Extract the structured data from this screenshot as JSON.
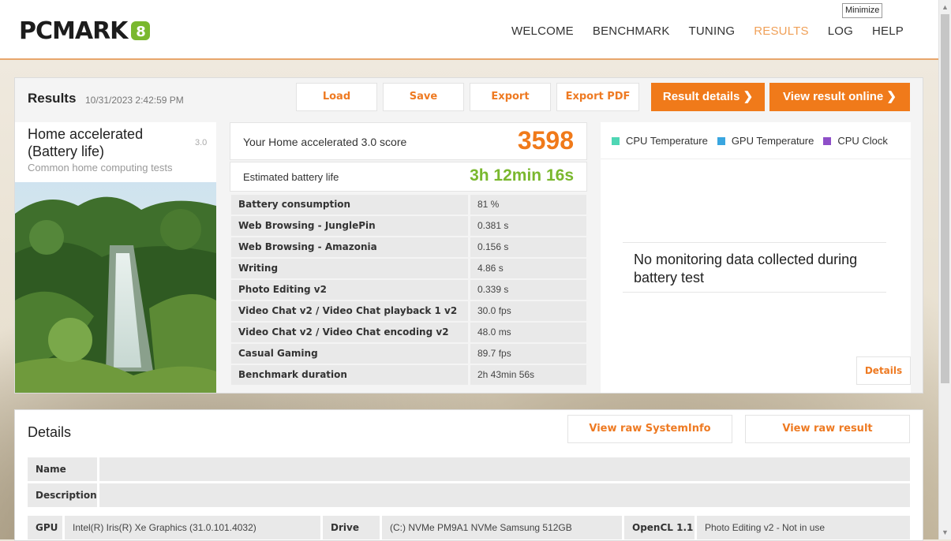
{
  "window": {
    "tooltip": "Minimize"
  },
  "header": {
    "logo_text": "PCMARK",
    "nav": [
      "WELCOME",
      "BENCHMARK",
      "TUNING",
      "RESULTS",
      "LOG",
      "HELP"
    ],
    "active_nav": "RESULTS"
  },
  "results": {
    "title": "Results",
    "date": "10/31/2023 2:42:59 PM",
    "buttons": {
      "load": "Load",
      "save": "Save",
      "export": "Export",
      "export_pdf": "Export PDF",
      "result_details": "Result details",
      "view_online": "View result online"
    },
    "test": {
      "name": "Home accelerated (Battery life)",
      "version": "3.0",
      "subtitle": "Common home computing tests"
    },
    "score": {
      "label": "Your Home accelerated 3.0 score",
      "value": "3598"
    },
    "battery": {
      "label": "Estimated battery life",
      "value": "3h 12min 16s"
    },
    "metrics": [
      {
        "name": "Battery consumption",
        "value": "81 %"
      },
      {
        "name": "Web Browsing - JunglePin",
        "value": "0.381 s"
      },
      {
        "name": "Web Browsing - Amazonia",
        "value": "0.156 s"
      },
      {
        "name": "Writing",
        "value": "4.86 s"
      },
      {
        "name": "Photo Editing v2",
        "value": "0.339 s"
      },
      {
        "name": "Video Chat v2 / Video Chat playback 1 v2",
        "value": "30.0 fps"
      },
      {
        "name": "Video Chat v2 / Video Chat encoding v2",
        "value": "48.0 ms"
      },
      {
        "name": "Casual Gaming",
        "value": "89.7 fps"
      },
      {
        "name": "Benchmark duration",
        "value": "2h 43min 56s"
      }
    ],
    "monitoring": {
      "legend": [
        {
          "label": "CPU Temperature",
          "color": "#4fd6b4"
        },
        {
          "label": "GPU Temperature",
          "color": "#3aa6e0"
        },
        {
          "label": "CPU Clock",
          "color": "#8e4fc8"
        }
      ],
      "message": "No monitoring data collected during battery test",
      "details_button": "Details"
    }
  },
  "details": {
    "title": "Details",
    "raw_systeminfo": "View raw SystemInfo",
    "raw_result": "View raw result",
    "rows": [
      {
        "key": "Name",
        "value": ""
      },
      {
        "key": "Description",
        "value": ""
      }
    ],
    "hardware": [
      {
        "key": "GPU",
        "value": "Intel(R) Iris(R) Xe Graphics (31.0.101.4032)"
      },
      {
        "key": "Drive",
        "value": "(C:) NVMe PM9A1 NVMe Samsung 512GB"
      },
      {
        "key": "OpenCL 1.1",
        "value": "Photo Editing v2 - Not in use"
      }
    ]
  }
}
